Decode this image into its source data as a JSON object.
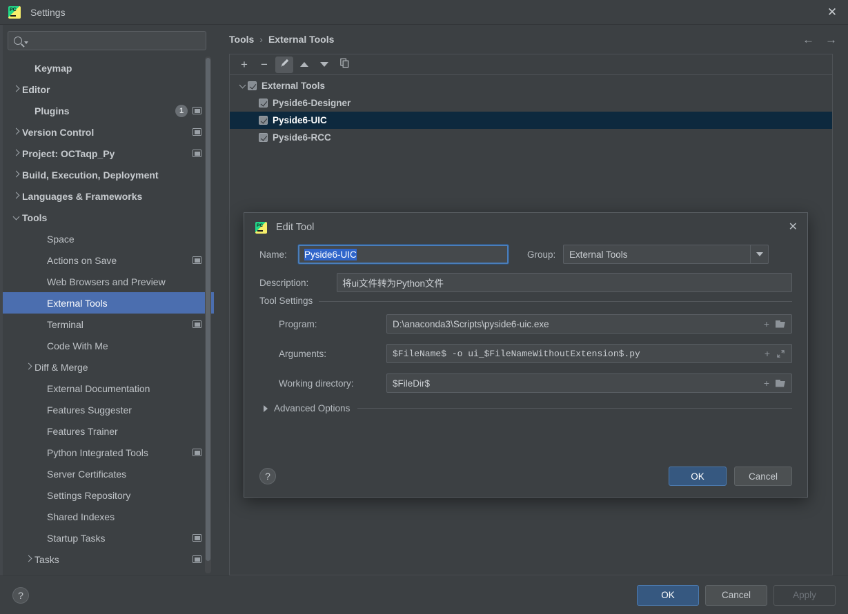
{
  "window": {
    "title": "Settings",
    "logo_icon": "pycharm-logo-icon",
    "close_icon": "close-icon"
  },
  "sidebar": {
    "search": {
      "value": "",
      "placeholder": "",
      "icon": "search-icon"
    },
    "items": [
      {
        "label": "Keymap",
        "indent": 1,
        "chevron": "none",
        "bold": true,
        "badge": null,
        "trailing_icon": null,
        "selected": false
      },
      {
        "label": "Editor",
        "indent": 0,
        "chevron": "right",
        "bold": true,
        "badge": null,
        "trailing_icon": null,
        "selected": false
      },
      {
        "label": "Plugins",
        "indent": 1,
        "chevron": "none",
        "bold": true,
        "badge": "1",
        "trailing_icon": "window-icon",
        "selected": false
      },
      {
        "label": "Version Control",
        "indent": 0,
        "chevron": "right",
        "bold": true,
        "badge": null,
        "trailing_icon": "window-icon",
        "selected": false
      },
      {
        "label": "Project: OCTaqp_Py",
        "indent": 0,
        "chevron": "right",
        "bold": true,
        "badge": null,
        "trailing_icon": "window-icon",
        "selected": false
      },
      {
        "label": "Build, Execution, Deployment",
        "indent": 0,
        "chevron": "right",
        "bold": true,
        "badge": null,
        "trailing_icon": null,
        "selected": false
      },
      {
        "label": "Languages & Frameworks",
        "indent": 0,
        "chevron": "right",
        "bold": true,
        "badge": null,
        "trailing_icon": null,
        "selected": false
      },
      {
        "label": "Tools",
        "indent": 0,
        "chevron": "down",
        "bold": true,
        "badge": null,
        "trailing_icon": null,
        "selected": false
      },
      {
        "label": "Space",
        "indent": 2,
        "chevron": "none",
        "bold": false,
        "badge": null,
        "trailing_icon": null,
        "selected": false
      },
      {
        "label": "Actions on Save",
        "indent": 2,
        "chevron": "none",
        "bold": false,
        "badge": null,
        "trailing_icon": "window-icon",
        "selected": false
      },
      {
        "label": "Web Browsers and Preview",
        "indent": 2,
        "chevron": "none",
        "bold": false,
        "badge": null,
        "trailing_icon": null,
        "selected": false
      },
      {
        "label": "External Tools",
        "indent": 2,
        "chevron": "none",
        "bold": false,
        "badge": null,
        "trailing_icon": null,
        "selected": true
      },
      {
        "label": "Terminal",
        "indent": 2,
        "chevron": "none",
        "bold": false,
        "badge": null,
        "trailing_icon": "window-icon",
        "selected": false
      },
      {
        "label": "Code With Me",
        "indent": 2,
        "chevron": "none",
        "bold": false,
        "badge": null,
        "trailing_icon": null,
        "selected": false
      },
      {
        "label": "Diff & Merge",
        "indent": 1,
        "chevron": "right",
        "bold": false,
        "badge": null,
        "trailing_icon": null,
        "selected": false
      },
      {
        "label": "External Documentation",
        "indent": 2,
        "chevron": "none",
        "bold": false,
        "badge": null,
        "trailing_icon": null,
        "selected": false
      },
      {
        "label": "Features Suggester",
        "indent": 2,
        "chevron": "none",
        "bold": false,
        "badge": null,
        "trailing_icon": null,
        "selected": false
      },
      {
        "label": "Features Trainer",
        "indent": 2,
        "chevron": "none",
        "bold": false,
        "badge": null,
        "trailing_icon": null,
        "selected": false
      },
      {
        "label": "Python Integrated Tools",
        "indent": 2,
        "chevron": "none",
        "bold": false,
        "badge": null,
        "trailing_icon": "window-icon",
        "selected": false
      },
      {
        "label": "Server Certificates",
        "indent": 2,
        "chevron": "none",
        "bold": false,
        "badge": null,
        "trailing_icon": null,
        "selected": false
      },
      {
        "label": "Settings Repository",
        "indent": 2,
        "chevron": "none",
        "bold": false,
        "badge": null,
        "trailing_icon": null,
        "selected": false
      },
      {
        "label": "Shared Indexes",
        "indent": 2,
        "chevron": "none",
        "bold": false,
        "badge": null,
        "trailing_icon": null,
        "selected": false
      },
      {
        "label": "Startup Tasks",
        "indent": 2,
        "chevron": "none",
        "bold": false,
        "badge": null,
        "trailing_icon": "window-icon",
        "selected": false
      },
      {
        "label": "Tasks",
        "indent": 1,
        "chevron": "right",
        "bold": false,
        "badge": null,
        "trailing_icon": "window-icon",
        "selected": false
      }
    ]
  },
  "main": {
    "breadcrumb": {
      "parent": "Tools",
      "separator": "›",
      "current": "External Tools"
    },
    "nav": {
      "back_icon": "arrow-left-icon",
      "forward_icon": "arrow-right-icon"
    },
    "toolbar": [
      {
        "name": "add-button",
        "icon": "plus-icon",
        "glyph": "+",
        "active": false
      },
      {
        "name": "remove-button",
        "icon": "minus-icon",
        "glyph": "−",
        "active": false
      },
      {
        "name": "edit-button",
        "icon": "pencil-icon",
        "glyph": "",
        "active": true
      },
      {
        "name": "move-up-button",
        "icon": "triangle-up-icon",
        "glyph": "",
        "active": false
      },
      {
        "name": "move-down-button",
        "icon": "triangle-down-icon",
        "glyph": "",
        "active": false
      },
      {
        "name": "copy-button",
        "icon": "copy-icon",
        "glyph": "",
        "active": false
      }
    ],
    "tree": [
      {
        "label": "External Tools",
        "level": 0,
        "chevron": "down",
        "checked": true,
        "selected": false
      },
      {
        "label": "Pyside6-Designer",
        "level": 1,
        "chevron": "none",
        "checked": true,
        "selected": false
      },
      {
        "label": "Pyside6-UIC",
        "level": 1,
        "chevron": "none",
        "checked": true,
        "selected": true
      },
      {
        "label": "Pyside6-RCC",
        "level": 1,
        "chevron": "none",
        "checked": true,
        "selected": false
      }
    ]
  },
  "dialog": {
    "title": "Edit Tool",
    "logo_icon": "pycharm-logo-icon",
    "close_icon": "close-icon",
    "name": {
      "label": "Name:",
      "value": "Pyside6-UIC",
      "selected": true
    },
    "group": {
      "label": "Group:",
      "value": "External Tools",
      "arrow_icon": "chevron-down-icon"
    },
    "description": {
      "label": "Description:",
      "value": "将ui文件转为Python文件"
    },
    "tool_settings": {
      "legend": "Tool Settings",
      "rows": [
        {
          "label": "Program:",
          "value": "D:\\anaconda3\\Scripts\\pyside6-uic.exe",
          "mono": false,
          "insert_icon": "plus-icon",
          "action_icon": "folder-icon"
        },
        {
          "label": "Arguments:",
          "value": "$FileName$ -o ui_$FileNameWithoutExtension$.py",
          "mono": true,
          "insert_icon": "plus-icon",
          "action_icon": "expand-icon"
        },
        {
          "label": "Working directory:",
          "value": "$FileDir$",
          "mono": false,
          "insert_icon": "plus-icon",
          "action_icon": "folder-icon"
        }
      ]
    },
    "advanced": {
      "label": "Advanced Options",
      "expanded": false,
      "chevron": "right"
    },
    "help_icon": "help-icon",
    "buttons": {
      "ok": "OK",
      "cancel": "Cancel"
    }
  },
  "footer": {
    "help_icon": "help-icon",
    "ok": "OK",
    "cancel": "Cancel",
    "apply": "Apply",
    "apply_enabled": false
  },
  "colors": {
    "background": "#3c4043",
    "sidebar_selection": "#4b6eaf",
    "tree_selection": "#0d293e",
    "primary_button": "#365880",
    "text_selection": "#2f65ca",
    "focus_border": "#4a7ebb"
  }
}
